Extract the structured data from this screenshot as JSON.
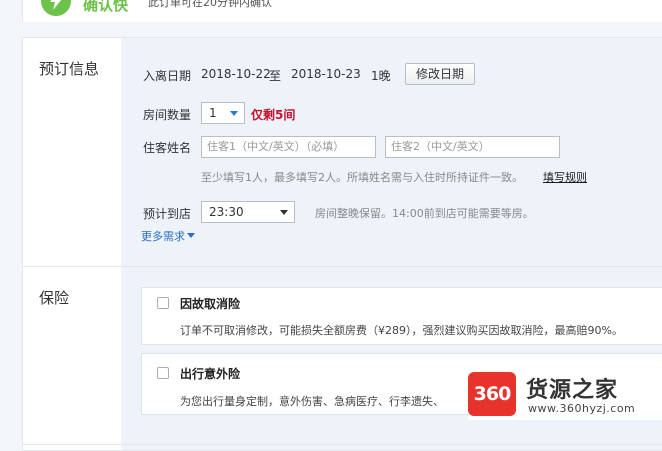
{
  "banner": {
    "icon": "lightning-icon",
    "label": "确认快",
    "desc": "此订单可在20分钟内确认"
  },
  "booking": {
    "title": "预订信息",
    "dates": {
      "label": "入离日期",
      "checkin": "2018-10-22",
      "separator": "至",
      "checkout": "2018-10-23",
      "nights": "1晚",
      "modify_button": "修改日期"
    },
    "rooms": {
      "label": "房间数量",
      "value": "1",
      "limit": "仅剩5间"
    },
    "guests": {
      "label": "住客姓名",
      "guest1_placeholder": "住客1（中文/英文）（必填）",
      "guest2_placeholder": "住客2（中文/英文）",
      "hint": "至少填写1人，最多填写2人。所填姓名需与入住时所持证件一致。",
      "rule_link": "填写规则"
    },
    "arrival": {
      "label": "预计到店",
      "value": "23:30",
      "hint": "房间整晚保留。14:00前到店可能需要等房。"
    },
    "more_link": "更多需求"
  },
  "insurance": {
    "title": "保险",
    "items": [
      {
        "title": "因故取消险",
        "desc": "订单不可取消修改，可能损失全额房费（¥289），强烈建议购买因故取消险，最高赔90%。"
      },
      {
        "title": "出行意外险",
        "desc": "为您出行量身定制，意外伤害、急病医疗、行李遗失、"
      }
    ]
  },
  "watermark": {
    "logo": "360",
    "name": "货源之家",
    "url": "www.360hyzj.com"
  },
  "colors": {
    "accent_green": "#6cc24a",
    "limit_red": "#c8102e",
    "link_blue": "#2a6fc1",
    "panel_blue": "#eef3f9"
  }
}
